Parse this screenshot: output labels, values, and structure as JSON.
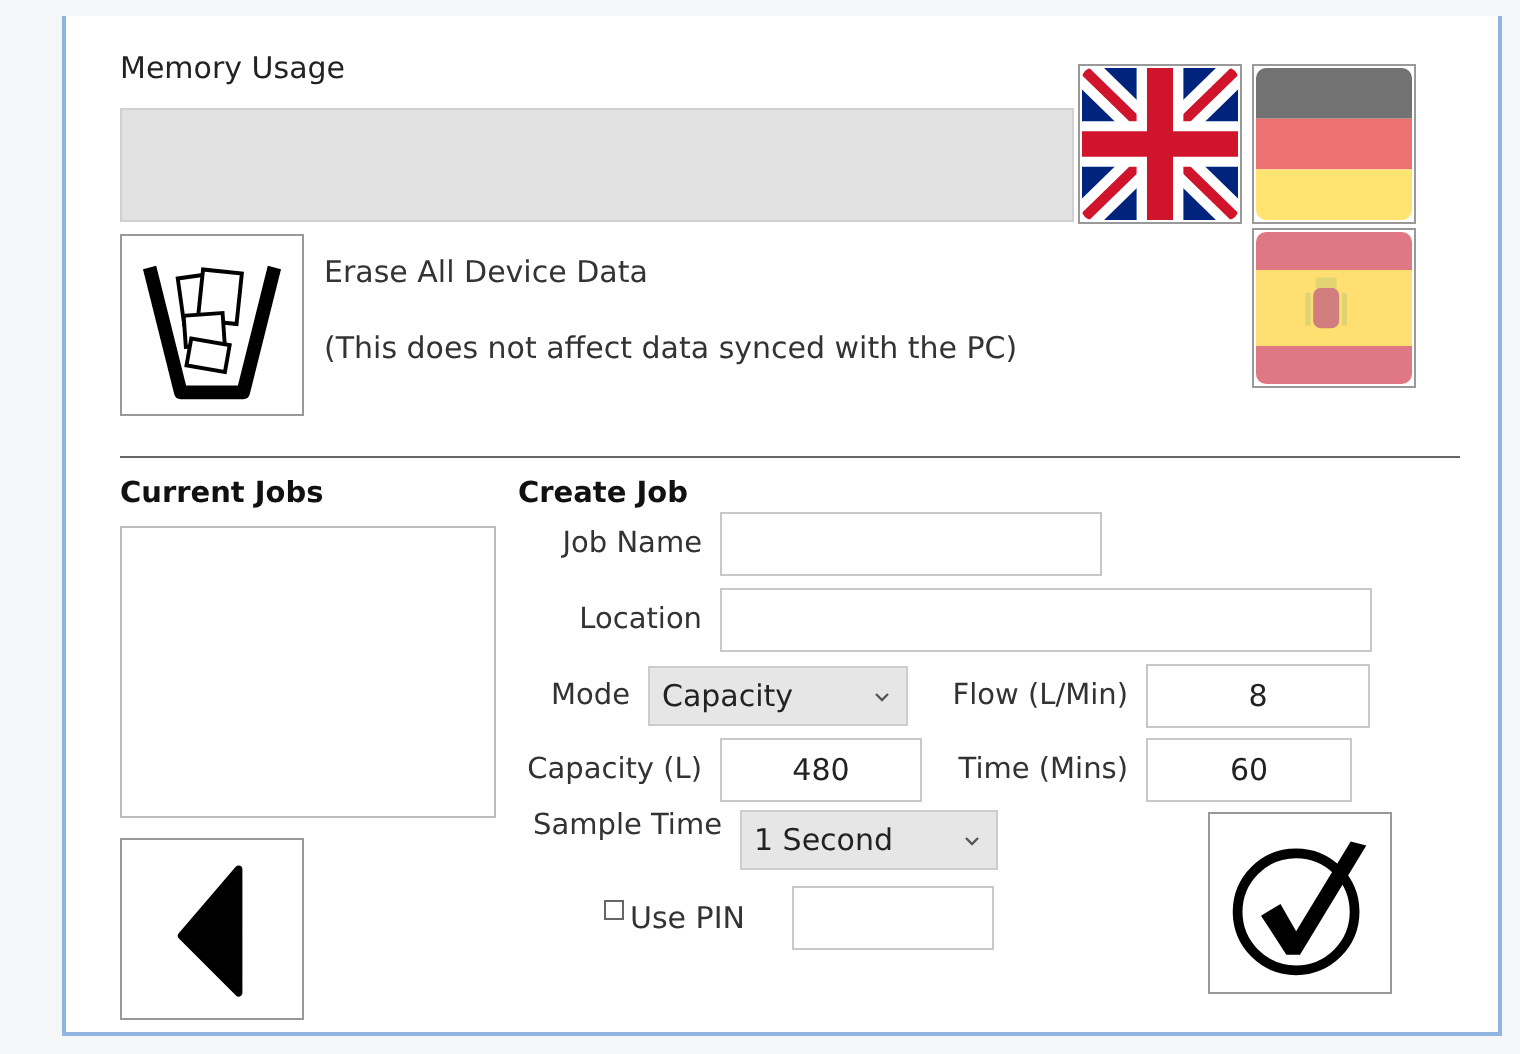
{
  "memory": {
    "label": "Memory Usage",
    "level": 0
  },
  "languages": [
    {
      "kind": "uk",
      "selected": true
    },
    {
      "kind": "de",
      "selected": false
    },
    {
      "kind": "es",
      "selected": false
    }
  ],
  "erase": {
    "title": "Erase All Device Data",
    "note": "(This does not affect data synced with the PC)"
  },
  "current_jobs": {
    "title": "Current Jobs"
  },
  "create_job": {
    "title": "Create Job",
    "job_name": {
      "label": "Job Name"
    },
    "location": {
      "label": "Location"
    },
    "mode": {
      "label": "Mode",
      "value": "Capacity"
    },
    "flow": {
      "label": "Flow (L/Min)",
      "value": "8"
    },
    "capacity": {
      "label": "Capacity (L)",
      "value": "480"
    },
    "time": {
      "label": "Time (Mins)",
      "value": "60"
    },
    "sample_time": {
      "label": "Sample Time",
      "value": "1 Second"
    },
    "use_pin": {
      "label": "Use PIN",
      "checked": false
    }
  }
}
